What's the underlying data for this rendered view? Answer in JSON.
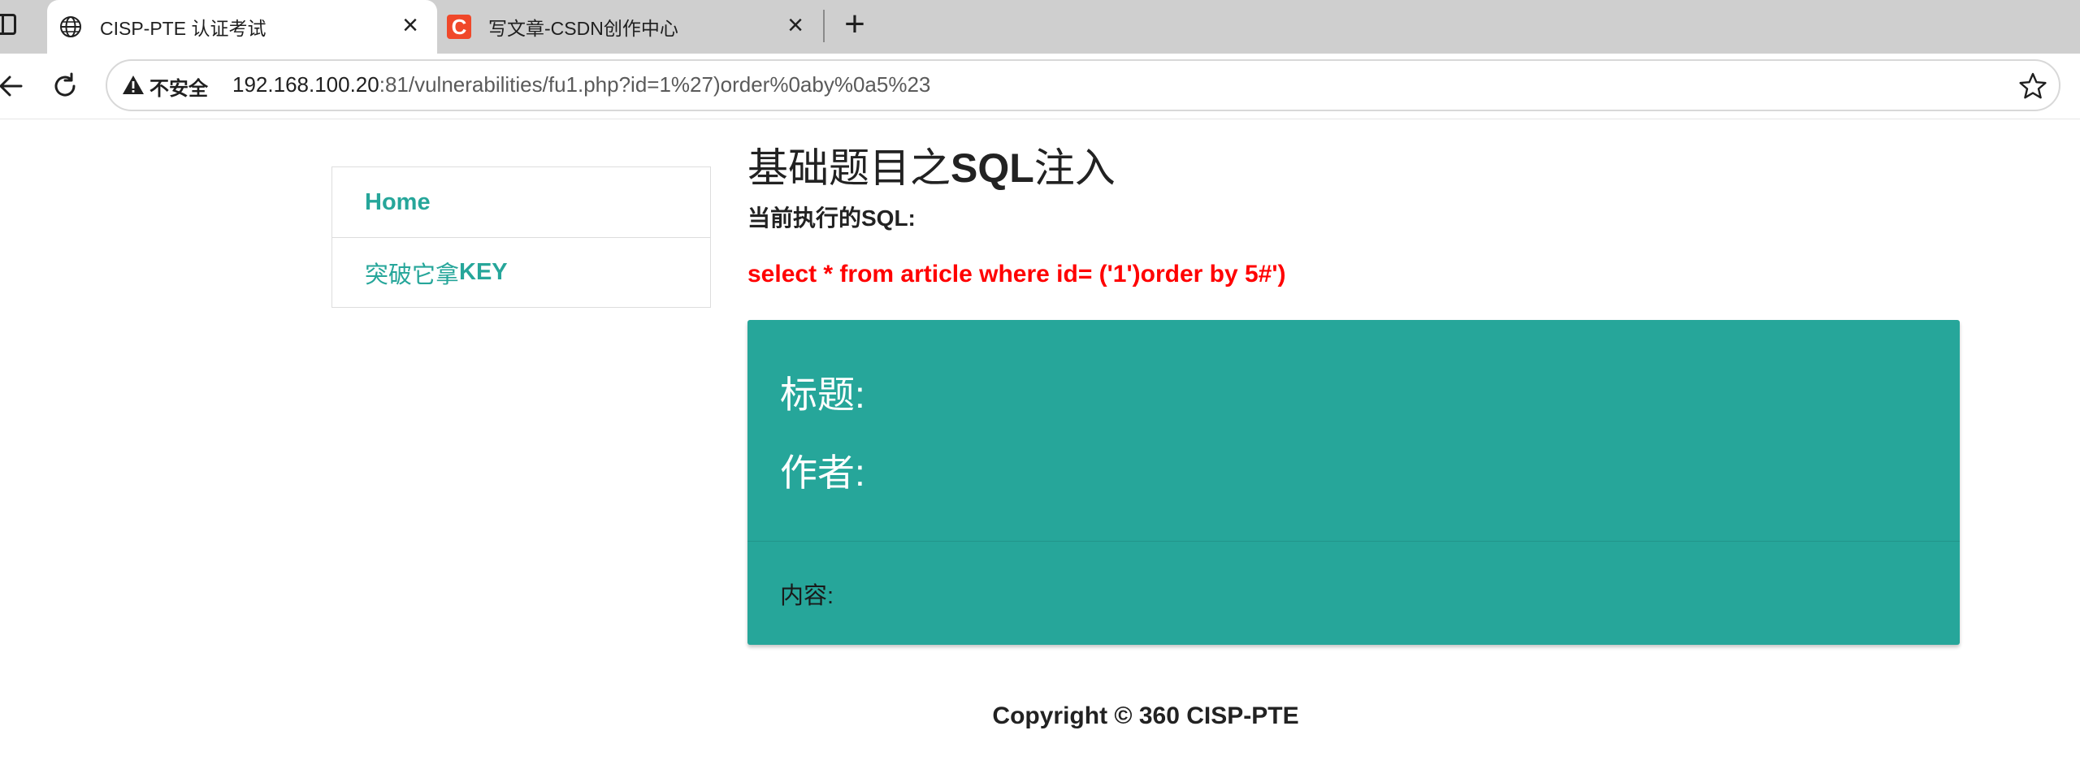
{
  "browser": {
    "tabs": [
      {
        "title": "CISP-PTE 认证考试",
        "active": true,
        "favicon": "globe-icon"
      },
      {
        "title": "写文章-CSDN创作中心",
        "active": false,
        "favicon": "csdn-c-icon",
        "favicon_letter": "C"
      }
    ],
    "tab_close_glyph": "×",
    "new_tab_glyph": "+",
    "address": {
      "security_label": "不安全",
      "url_host": "192.168.100.20",
      "url_rest": ":81/vulnerabilities/fu1.php?id=1%27)order%0aby%0a5%23"
    },
    "colors": {
      "tabbar": "#cfcfcf",
      "warning": "#1f1f1f"
    }
  },
  "sidebar": {
    "items": [
      {
        "label": "Home"
      },
      {
        "label_prefix": "突破它拿",
        "label_strong": "KEY"
      }
    ],
    "color": "#26a69a"
  },
  "main": {
    "title_prefix": "基础题目之",
    "title_strong": "SQL",
    "title_suffix": "注入",
    "sql_caption": "当前执行的SQL:",
    "sql_query": "select * from article where id= ('1')order by 5#')",
    "sql_color": "#ff0000",
    "card": {
      "title_label": "标题:",
      "author_label": "作者:",
      "content_label": "内容:",
      "color": "#26a69a"
    }
  },
  "footer": {
    "text": "Copyright © 360 CISP-PTE"
  }
}
